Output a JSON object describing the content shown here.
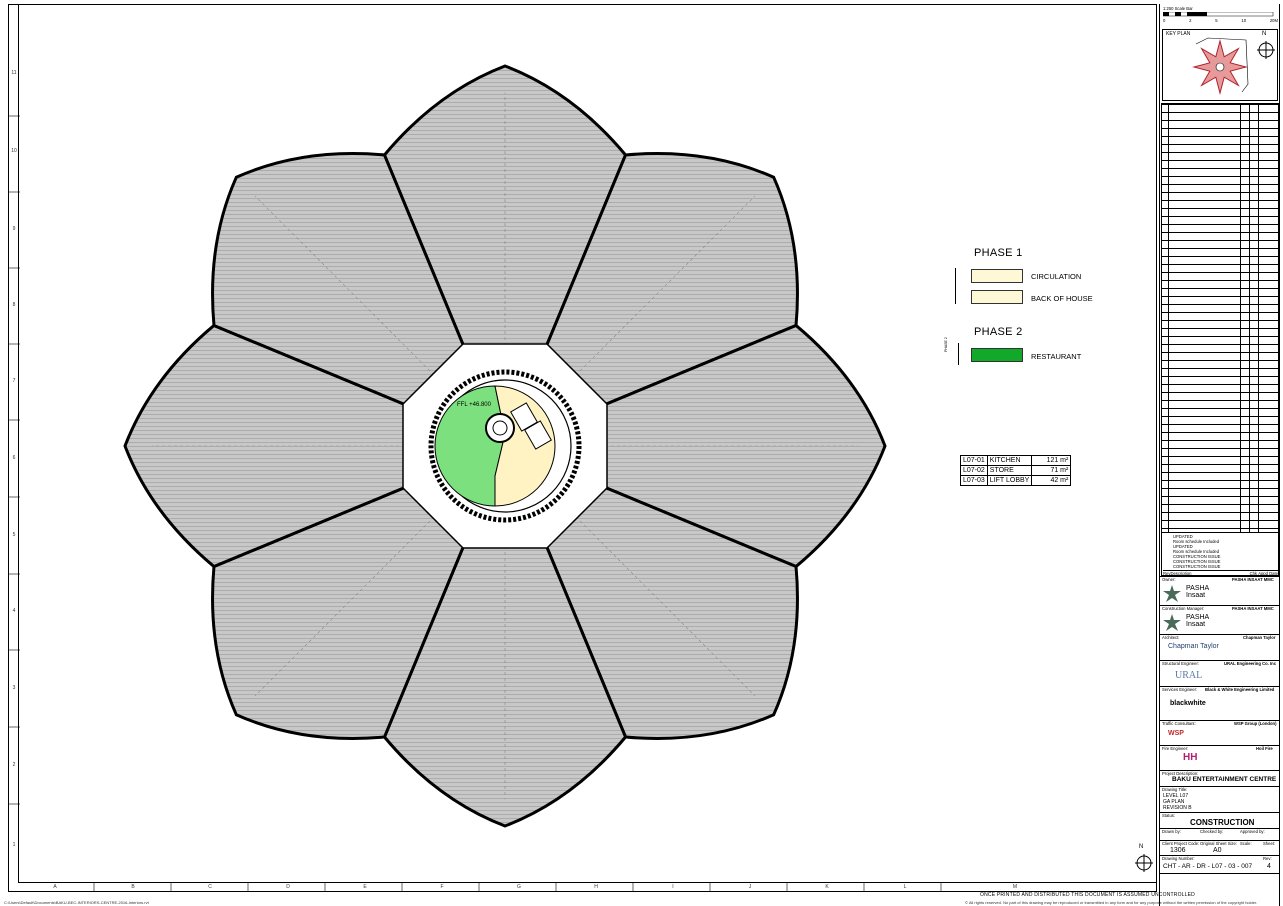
{
  "scale_bar": {
    "title": "1:250 Scale Bar",
    "ticks": [
      "0",
      "2",
      "5",
      "",
      "10",
      "",
      "",
      "",
      "20M"
    ]
  },
  "key_plan": {
    "title": "KEY PLAN",
    "north": "N"
  },
  "legend": {
    "phase1": {
      "title": "PHASE 1",
      "items": [
        {
          "label": "CIRCULATION",
          "color": "#fff8d6"
        },
        {
          "label": "BACK OF HOUSE",
          "color": "#fff8d6"
        }
      ]
    },
    "phase2": {
      "title": "PHASE 2",
      "items": [
        {
          "label": "RESTAURANT",
          "color": "#12a829"
        }
      ]
    },
    "phase2_side": "PHASE 2"
  },
  "plan": {
    "ffl": "FFL +46.800",
    "restaurant_color": "#7ce07e",
    "boh_color": "#fff3c4",
    "petal_color": "#b9b9b9"
  },
  "room_schedule": [
    {
      "code": "L07-01",
      "name": "KITCHEN",
      "area": "121 m²"
    },
    {
      "code": "L07-02",
      "name": "STORE",
      "area": "71 m²"
    },
    {
      "code": "L07-03",
      "name": "LIFT LOBBY",
      "area": "42 m²"
    }
  ],
  "row_labels": [
    "11",
    "10",
    "9",
    "8",
    "7",
    "6",
    "5",
    "4",
    "3",
    "2",
    "1"
  ],
  "col_labels": [
    "A",
    "B",
    "C",
    "D",
    "E",
    "F",
    "G",
    "H",
    "I",
    "J",
    "K",
    "L",
    "M"
  ],
  "revisions": [
    {
      "rev": "",
      "desc": "UPDATED"
    },
    {
      "rev": "",
      "desc": "Room schedule Included"
    },
    {
      "rev": "",
      "desc": "UPDATED"
    },
    {
      "rev": "",
      "desc": "Room schedule Included"
    },
    {
      "rev": "",
      "desc": "CONSTRUCTION ISSUE"
    },
    {
      "rev": "",
      "desc": "CONSTRUCTION ISSUE"
    },
    {
      "rev": "",
      "desc": "CONSTRUCTION ISSUE"
    }
  ],
  "rev_headers": [
    "Rev",
    "Description",
    "Chk",
    "Appd",
    "Date"
  ],
  "owner": {
    "role": "Owner:",
    "company": "PASHA INSAAT MMC",
    "logo": "PASHA Insaat"
  },
  "construction_manager": {
    "role": "Construction Manager:",
    "company": "PASHA INSAAT MMC",
    "logo": "PASHA Insaat"
  },
  "architect": {
    "role": "Architect:",
    "company": "Chapman Taylor",
    "logo": "Chapman Taylor"
  },
  "structural": {
    "role": "Structural Engineer:",
    "company": "URAL Engineering Co. Inc",
    "logo": "URAL"
  },
  "services": {
    "role": "Services Engineer:",
    "company": "Black & White Engineering Limited",
    "logo": "blackwhite"
  },
  "traffic": {
    "role": "Traffic Consultant:",
    "company": "WSP Group (London)",
    "logo": "WSP"
  },
  "fire": {
    "role": "Fire Engineer:",
    "company": "Hoil Fire",
    "logo": "HH"
  },
  "project": {
    "label": "Project Description:",
    "name": "BAKU ENTERTAINMENT CENTRE"
  },
  "drawing": {
    "label": "Drawing Title:",
    "lines": [
      "LEVEL L07",
      "GA PLAN",
      "REVISION B"
    ]
  },
  "status": {
    "label": "Status:",
    "value": "CONSTRUCTION"
  },
  "meta": {
    "drawn_by_label": "Drawn by:",
    "checked_by_label": "Checked by:",
    "approved_by_label": "Approved by:",
    "project_code_label": "Client Project Code:",
    "project_code": "1306",
    "sheet_size_label": "Original Sheet Size:",
    "sheet_size": "A0",
    "scale_label": "Scale:",
    "sheet_label": "Sheet:",
    "drawing_number_label": "Drawing Number:",
    "drawing_number": "CHT - AR - DR - L07 - 03 - 007",
    "rev_label": "Rev:",
    "rev": "4"
  },
  "footer_text": "ONCE PRINTED AND DISTRIBUTED THIS DOCUMENT IS ASSUMED UNCONTROLLED",
  "file_path": "C:\\Users\\Default\\Documents\\BAKU-BEC-INTERIORS-CENTRE-2016-Interiors.rvt",
  "copyright": "© All rights reserved. No part of this drawing may be reproduced or transmitted in any form and for any purpose without the written permission of the copyright holder.",
  "north_label": "N"
}
